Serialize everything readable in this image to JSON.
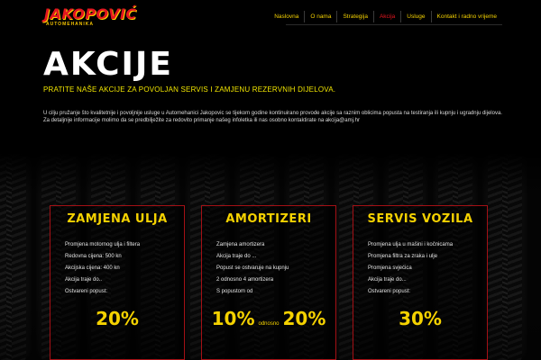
{
  "brand": {
    "name": "JAKOPOVIĆ",
    "subtitle": "AUTOMEHANIKA"
  },
  "nav": {
    "items": [
      {
        "label": "Naslovna"
      },
      {
        "label": "O nama"
      },
      {
        "label": "Strategija"
      },
      {
        "label": "Akcija",
        "active": true
      },
      {
        "label": "Usluge"
      },
      {
        "label": "Kontakt i radno vrijeme"
      }
    ]
  },
  "page": {
    "title": "AKCIJE",
    "lead": "PRATITE NAŠE AKCIJE ZA POVOLJAN SERVIS I ZAMJENU REZERVNIH DIJELOVA.",
    "desc1": "U cilju pružanje što kvalitetnije i povoljnije usluge u Automehanici Jakopovic se tijekom godine kontinuirano provode akcije sa raznim oblicima popusta na testiranja ili kupnju i ugradnju dijelova.",
    "desc2": "Za detaljnije informacije molimo da se predbilježite za redovito primanje našeg infoletka ili nas osobno kontaktirate na akcija@amj.hr"
  },
  "cards": [
    {
      "title": "ZAMJENA ULJA",
      "items": [
        "Promjena motornog ulja i filtera",
        "Redovna cijena: 500 kn",
        "Akcijska cijena: 400 kn",
        "Akcija traje do..",
        "Ostvareni popust:"
      ],
      "price": "20%"
    },
    {
      "title": "AMORTIZERI",
      "items": [
        "Zamjena amortizera",
        "Akcija traje do ...",
        "Popust se ostvaruje na kupnju",
        "2 odnosno 4 amortizera",
        "S popustom od"
      ],
      "price_a": "10%",
      "price_join": "odnosno",
      "price_b": "20%"
    },
    {
      "title": "SERVIS VOZILA",
      "items": [
        "Promjena ulja u mašini i kočnicama",
        "Promjena filtra za zraka i ulje",
        "Promjena svjećica",
        "Akcija traje do...",
        "Ostvareni popust:"
      ],
      "price": "30%"
    }
  ],
  "colors": {
    "accent": "#f5d200",
    "brand_red": "#e3161f",
    "border": "#a41015",
    "background": "#000000"
  }
}
